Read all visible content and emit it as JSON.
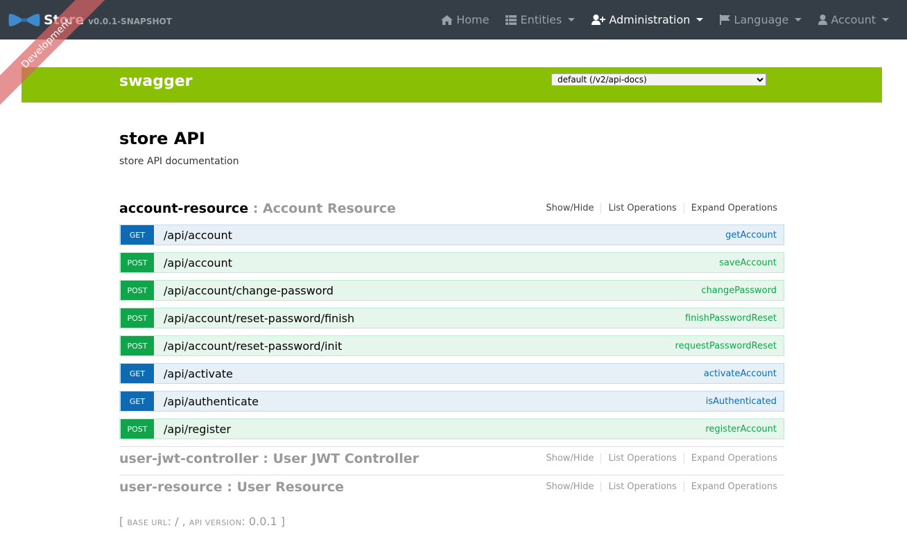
{
  "navbar": {
    "brand_name": "Store",
    "version": "v0.0.1-SNAPSHOT",
    "items": [
      {
        "label": "Home",
        "icon": "home-icon",
        "dropdown": false
      },
      {
        "label": "Entities",
        "icon": "th-list-icon",
        "dropdown": true
      },
      {
        "label": "Administration",
        "icon": "user-plus-icon",
        "dropdown": true
      },
      {
        "label": "Language",
        "icon": "flag-icon",
        "dropdown": true
      },
      {
        "label": "Account",
        "icon": "user-icon",
        "dropdown": true
      }
    ]
  },
  "ribbon": "Development",
  "swagger": {
    "title": "swagger",
    "spec_selected": "default (/v2/api-docs)"
  },
  "info": {
    "title": "store API",
    "description": "store API documentation"
  },
  "resources": [
    {
      "name": "account-resource",
      "separator": " : ",
      "description": "Account Resource",
      "ops_labels": [
        "Show/Hide",
        "List Operations",
        "Expand Operations"
      ],
      "operations": [
        {
          "method": "GET",
          "path": "/api/account",
          "nickname": "getAccount"
        },
        {
          "method": "POST",
          "path": "/api/account",
          "nickname": "saveAccount"
        },
        {
          "method": "POST",
          "path": "/api/account/change-password",
          "nickname": "changePassword"
        },
        {
          "method": "POST",
          "path": "/api/account/reset-password/finish",
          "nickname": "finishPasswordReset"
        },
        {
          "method": "POST",
          "path": "/api/account/reset-password/init",
          "nickname": "requestPasswordReset"
        },
        {
          "method": "GET",
          "path": "/api/activate",
          "nickname": "activateAccount"
        },
        {
          "method": "GET",
          "path": "/api/authenticate",
          "nickname": "isAuthenticated"
        },
        {
          "method": "POST",
          "path": "/api/register",
          "nickname": "registerAccount"
        }
      ]
    },
    {
      "name": "user-jwt-controller",
      "separator": " : ",
      "description": "User JWT Controller",
      "ops_labels": [
        "Show/Hide",
        "List Operations",
        "Expand Operations"
      ]
    },
    {
      "name": "user-resource",
      "separator": " : ",
      "description": "User Resource",
      "ops_labels": [
        "Show/Hide",
        "List Operations",
        "Expand Operations"
      ]
    }
  ],
  "footer": {
    "open": "[ ",
    "base_url_label": "base url",
    "base_url": "/",
    "comma": " , ",
    "api_version_label": "api version",
    "api_version": "0.0.1",
    "close": " ]"
  },
  "colors": {
    "navbar": "#353d47",
    "swagger_green": "#89bf04",
    "get": "#0f6ab4",
    "post": "#10a54a"
  }
}
